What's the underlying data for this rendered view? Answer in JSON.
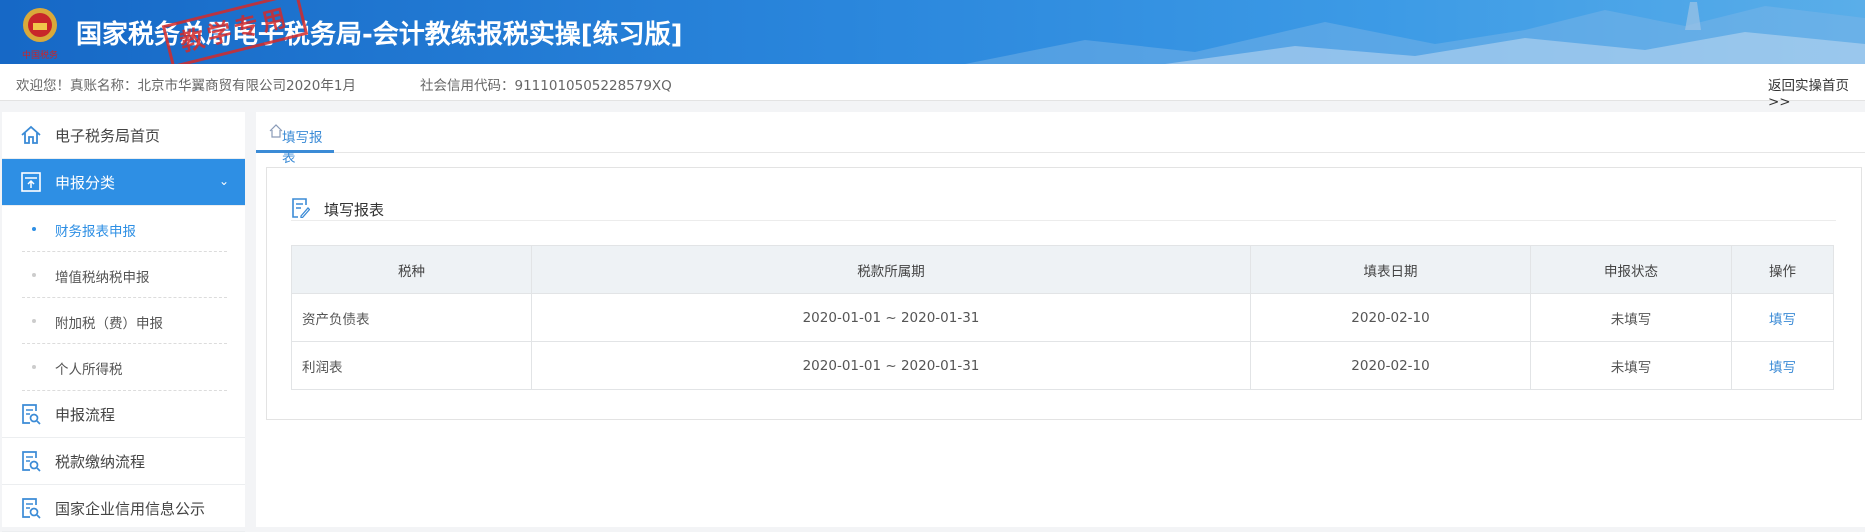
{
  "header": {
    "title": "国家税务总局电子税务局-会计教练报税实操[练习版]",
    "stamp": "教学专用",
    "emblem_caption": "中国税务"
  },
  "info": {
    "welcome": "欢迎您！真账名称：北京市华翼商贸有限公司2020年1月",
    "credit_code": "社会信用代码：9111010505228579XQ",
    "return_link": "返回实操首页 >>"
  },
  "sidebar": {
    "items": [
      {
        "label": "电子税务局首页",
        "icon": "home-icon"
      },
      {
        "label": "申报分类",
        "icon": "upload-doc-icon",
        "active": true
      }
    ],
    "subitems": [
      {
        "label": "财务报表申报",
        "current": true
      },
      {
        "label": "增值税纳税申报"
      },
      {
        "label": "附加税（费）申报"
      },
      {
        "label": "个人所得税"
      }
    ],
    "more": [
      {
        "label": "申报流程"
      },
      {
        "label": "税款缴纳流程"
      },
      {
        "label": "国家企业信用信息公示"
      }
    ]
  },
  "tab": {
    "label": "填写报表"
  },
  "card": {
    "title": "填写报表"
  },
  "table": {
    "columns": [
      "税种",
      "税款所属期",
      "填表日期",
      "申报状态",
      "操作"
    ],
    "rows": [
      {
        "tax": "资产负债表",
        "period": "2020-01-01 ~ 2020-01-31",
        "date": "2020-02-10",
        "status": "未填写",
        "action": "填写"
      },
      {
        "tax": "利润表",
        "period": "2020-01-01 ~ 2020-01-31",
        "date": "2020-02-10",
        "status": "未填写",
        "action": "填写"
      }
    ]
  },
  "colors": {
    "accent": "#2e8fe4",
    "link": "#3b8bd6",
    "stamp": "#d42a2a"
  }
}
